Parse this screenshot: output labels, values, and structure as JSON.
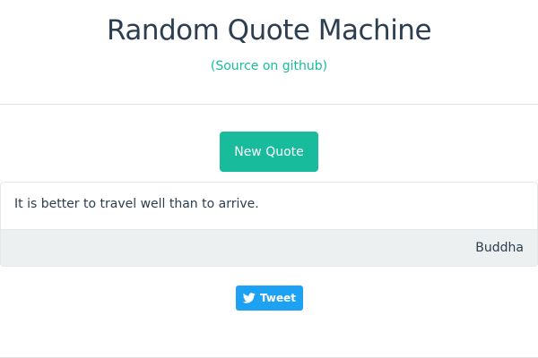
{
  "header": {
    "title": "Random Quote Machine",
    "source_open": "(",
    "source_link": "Source on github",
    "source_close": ")"
  },
  "actions": {
    "new_quote_label": "New Quote",
    "tweet_label": "Tweet",
    "tweet_icon": "twitter-bird-icon"
  },
  "quote": {
    "text": "It is better to travel well than to arrive.",
    "author": "Buddha"
  },
  "colors": {
    "primary": "#18bc9c",
    "text": "#2c3e50",
    "twitter": "#1da1f2",
    "footer_bg": "#ecf0f1"
  }
}
